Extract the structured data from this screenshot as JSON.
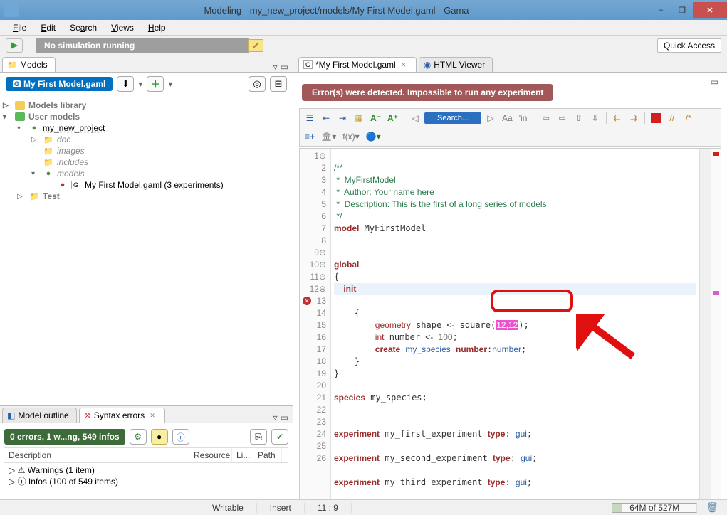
{
  "window": {
    "title": "Modeling - my_new_project/models/My First Model.gaml - Gama",
    "minimize": "–",
    "maximize": "❐",
    "close": "✕"
  },
  "menu": {
    "file": "File",
    "edit": "Edit",
    "search": "Search",
    "views": "Views",
    "help": "Help"
  },
  "toolbar": {
    "sim_status": "No simulation running",
    "quick_access": "Quick Access"
  },
  "models_panel": {
    "tab": "Models",
    "current_file": "My First Model.gaml",
    "tree": {
      "models_library": "Models library",
      "user_models": "User models",
      "project": "my_new_project",
      "doc": "doc",
      "images": "images",
      "includes": "includes",
      "models": "models",
      "model_file": "My First Model.gaml (3 experiments)",
      "test": "Test"
    }
  },
  "bottom_panel": {
    "tab_outline": "Model outline",
    "tab_syntax": "Syntax errors",
    "summary": "0 errors, 1 w...ng, 549 infos",
    "col_desc": "Description",
    "col_res": "Resource",
    "col_line": "Li...",
    "col_path": "Path",
    "warnings": "Warnings (1 item)",
    "infos": "Infos (100 of 549 items)"
  },
  "editor": {
    "tab_file": "*My First Model.gaml",
    "tab_viewer": "HTML Viewer",
    "error_banner": "Error(s) were detected. Impossible to run any experiment",
    "search_placeholder": "Search...",
    "lines": [
      "/**",
      " *  MyFirstModel",
      " *  Author: Your name here",
      " *  Description: This is the first of a long series of models",
      " */",
      "model MyFirstModel",
      "",
      "",
      "global",
      "{",
      "    init",
      "    {",
      "        geometry shape <- square(12,12);",
      "        int number <- 100;",
      "        create my_species number:number;",
      "    }",
      "}",
      "",
      "species my_species;",
      "",
      "",
      "experiment my_first_experiment type: gui;",
      "",
      "experiment my_second_experiment type: gui;",
      "",
      "experiment my_third_experiment type: gui;"
    ]
  },
  "status": {
    "writable": "Writable",
    "mode": "Insert",
    "pos": "11 : 9",
    "mem": "64M of 527M"
  }
}
